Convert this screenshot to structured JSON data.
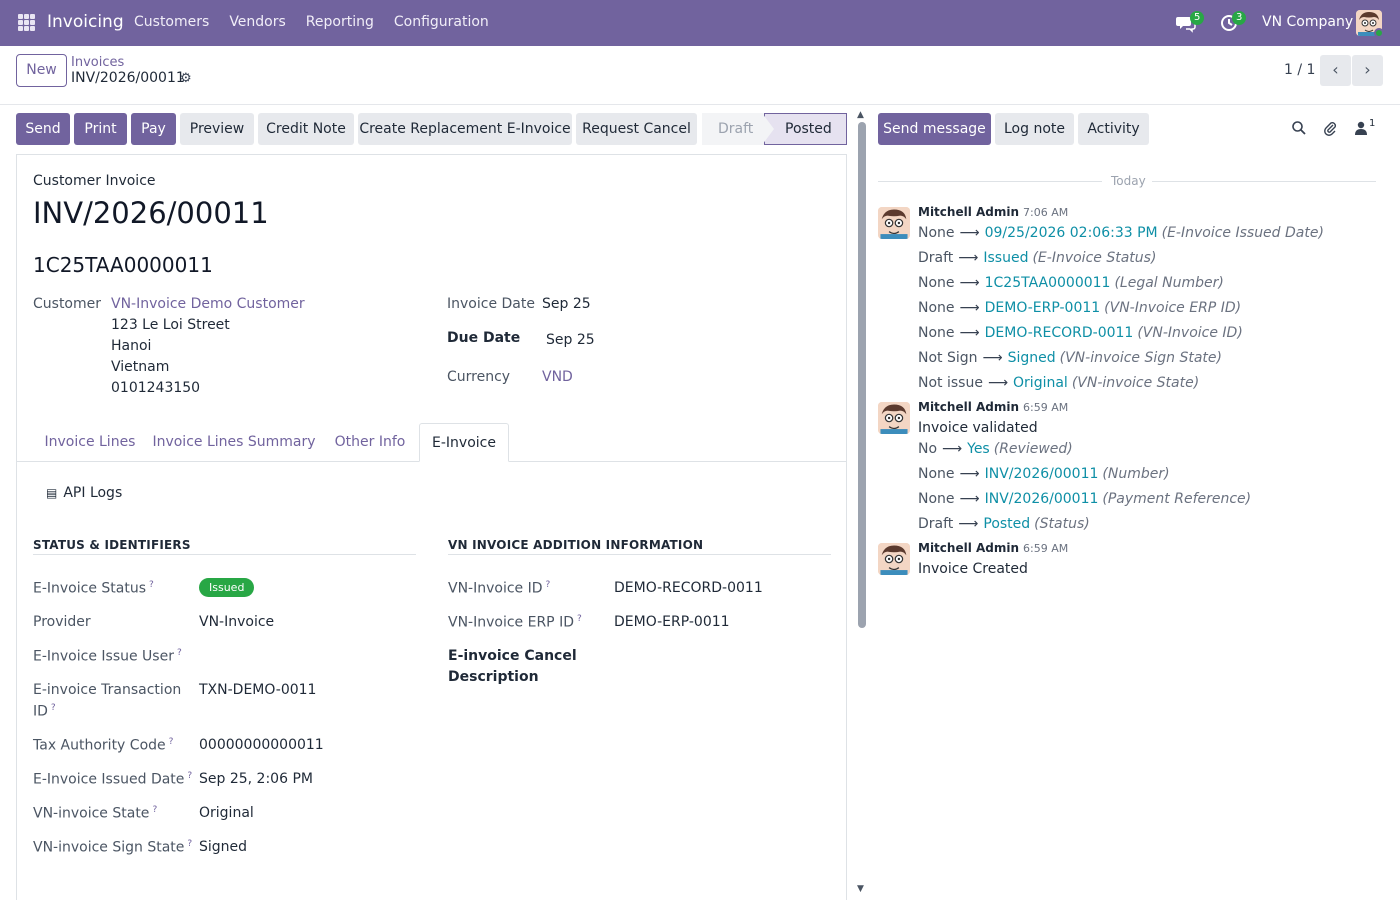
{
  "navbar": {
    "app_name": "Invoicing",
    "menu": [
      "Customers",
      "Vendors",
      "Reporting",
      "Configuration"
    ],
    "messages_count": "5",
    "activities_count": "3",
    "company": "VN Company"
  },
  "control_panel": {
    "new_label": "New",
    "breadcrumb_parent": "Invoices",
    "breadcrumb_current": "INV/2026/00011",
    "pager": "1 / 1"
  },
  "actions": {
    "send": "Send",
    "print": "Print",
    "pay": "Pay",
    "preview": "Preview",
    "credit_note": "Credit Note",
    "create_replacement": "Create Replacement E-Invoice",
    "request_cancel": "Request Cancel",
    "status_draft": "Draft",
    "status_posted": "Posted"
  },
  "invoice": {
    "type_label": "Customer Invoice",
    "name": "INV/2026/00011",
    "legal_number": "1C25TAA0000011",
    "customer_label": "Customer",
    "customer_name": "VN-Invoice Demo Customer",
    "address_street": "123 Le Loi Street",
    "address_city": "Hanoi",
    "address_country": "Vietnam",
    "customer_vat": "0101243150",
    "invoice_date_label": "Invoice Date",
    "invoice_date": "Sep 25",
    "due_date_label": "Due Date",
    "due_date": "Sep 25",
    "currency_label": "Currency",
    "currency": "VND"
  },
  "tabs": [
    "Invoice Lines",
    "Invoice Lines Summary",
    "Other Info",
    "E-Invoice"
  ],
  "einvoice": {
    "api_logs": "API Logs",
    "status_section": "STATUS & IDENTIFIERS",
    "addition_section": "VN INVOICE ADDITION INFORMATION",
    "status_label": "E-Invoice Status",
    "status_value": "Issued",
    "provider_label": "Provider",
    "provider_value": "VN-Invoice",
    "issue_user_label": "E-Invoice Issue User",
    "transaction_label": "E-invoice Transaction",
    "transaction_label_2": "ID",
    "transaction_value": "TXN-DEMO-0011",
    "tax_code_label": "Tax Authority Code",
    "tax_code_value": "00000000000011",
    "issued_date_label": "E-Invoice Issued Date",
    "issued_date_value": "Sep 25, 2:06 PM",
    "state_label": "VN-invoice State",
    "state_value": "Original",
    "sign_state_label": "VN-invoice Sign State",
    "sign_state_value": "Signed",
    "vn_id_label": "VN-Invoice ID",
    "vn_id_value": "DEMO-RECORD-0011",
    "vn_erp_label": "VN-Invoice ERP ID",
    "vn_erp_value": "DEMO-ERP-0011",
    "cancel_desc_label": "E-invoice Cancel",
    "cancel_desc_label_2": "Description"
  },
  "chatter": {
    "send_message": "Send message",
    "log_note": "Log note",
    "activity": "Activity",
    "followers_count": "1",
    "today": "Today",
    "messages": [
      {
        "author": "Mitchell Admin",
        "time": "7:06 AM",
        "tracking": [
          {
            "old": "None",
            "new": "09/25/2026 02:06:33 PM",
            "field": "(E-Invoice Issued Date)"
          },
          {
            "old": "Draft",
            "new": "Issued",
            "field": "(E-Invoice Status)"
          },
          {
            "old": "None",
            "new": "1C25TAA0000011",
            "field": "(Legal Number)"
          },
          {
            "old": "None",
            "new": "DEMO-ERP-0011",
            "field": "(VN-Invoice ERP ID)"
          },
          {
            "old": "None",
            "new": "DEMO-RECORD-0011",
            "field": "(VN-Invoice ID)"
          },
          {
            "old": "Not Sign",
            "new": "Signed",
            "field": "(VN-invoice Sign State)"
          },
          {
            "old": "Not issue",
            "new": "Original",
            "field": "(VN-invoice State)"
          }
        ]
      },
      {
        "author": "Mitchell Admin",
        "time": "6:59 AM",
        "body": "Invoice validated",
        "tracking": [
          {
            "old": "No",
            "new": "Yes",
            "field": "(Reviewed)"
          },
          {
            "old": "None",
            "new": "INV/2026/00011",
            "field": "(Number)"
          },
          {
            "old": "None",
            "new": "INV/2026/00011",
            "field": "(Payment Reference)"
          },
          {
            "old": "Draft",
            "new": "Posted",
            "field": "(Status)"
          }
        ]
      },
      {
        "author": "Mitchell Admin",
        "time": "6:59 AM",
        "body": "Invoice Created"
      }
    ]
  }
}
